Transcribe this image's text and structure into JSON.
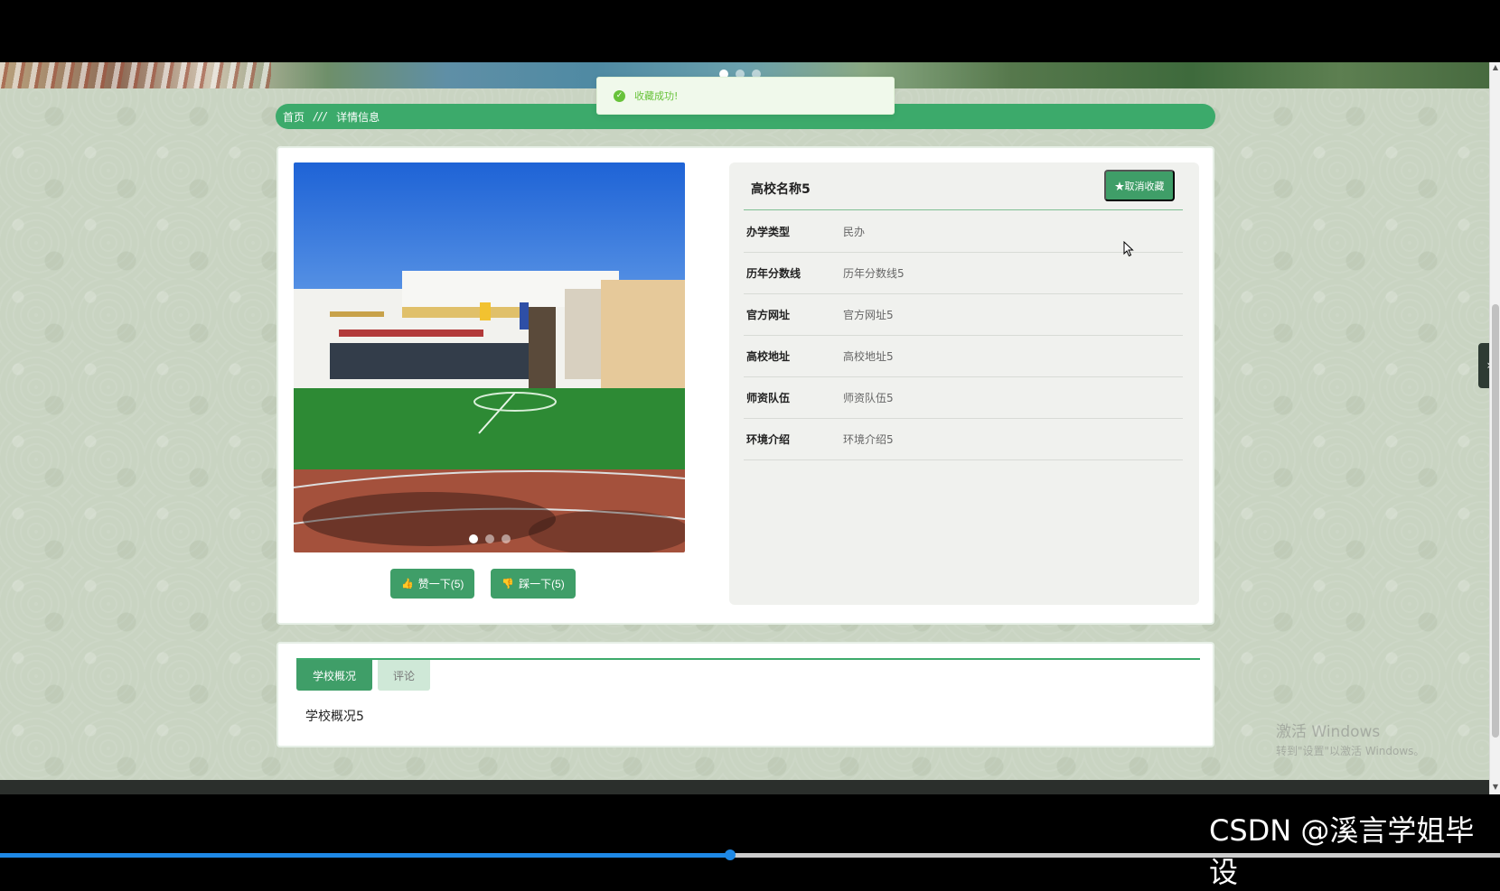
{
  "banner": {
    "slide_count": 3,
    "active_slide": 1
  },
  "toast": {
    "icon": "check-circle-icon",
    "message": "收藏成功!"
  },
  "breadcrumb": {
    "home": "首页",
    "separator": "///",
    "current": "详情信息"
  },
  "detail": {
    "title": "高校名称5",
    "favorite_button": "★取消收藏",
    "fields": [
      {
        "label": "办学类型",
        "value": "民办"
      },
      {
        "label": "历年分数线",
        "value": "历年分数线5"
      },
      {
        "label": "官方网址",
        "value": "官方网址5"
      },
      {
        "label": "高校地址",
        "value": "高校地址5"
      },
      {
        "label": "师资队伍",
        "value": "师资队伍5"
      },
      {
        "label": "环境介绍",
        "value": "环境介绍5"
      }
    ],
    "photo": {
      "slide_count": 3,
      "active_slide": 1
    },
    "like_button": "赞一下(5)",
    "dislike_button": "踩一下(5)"
  },
  "tabs": {
    "items": [
      {
        "label": "学校概况",
        "active": true
      },
      {
        "label": "评论",
        "active": false
      }
    ],
    "content": "学校概况5"
  },
  "watermark": {
    "line1": "激活 Windows",
    "line2": "转到\"设置\"以激活 Windows。"
  },
  "overlay": {
    "csdn_watermark": "CSDN @溪言学姐毕设"
  },
  "video": {
    "progress_fraction": 0.487
  },
  "colors": {
    "accent": "#3caa6b",
    "button": "#3f9e68",
    "toast_text": "#67c23a"
  }
}
